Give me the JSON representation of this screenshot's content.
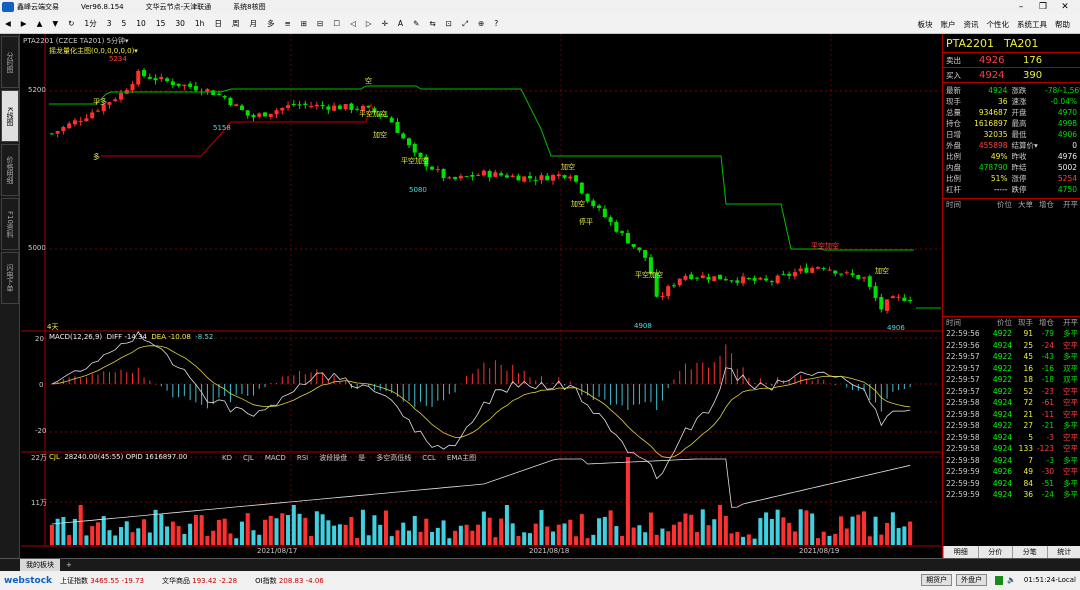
{
  "window": {
    "app_title": "鑫峰云端交易",
    "version": "Ver96.8.154",
    "node": "文华云节点-天津联通",
    "system_info": "系统8核图"
  },
  "toolbar": {
    "items": [
      "◀",
      "▶",
      "▲",
      "▼",
      "↻",
      "1分",
      "3",
      "5",
      "10",
      "15",
      "30",
      "1h",
      "日",
      "周",
      "月",
      "多",
      "≡",
      "⊞",
      "⊟",
      "☐",
      "◁",
      "▷",
      "✛",
      "A",
      "✎",
      "⇆",
      "⊡",
      "⤢",
      "⊕",
      "?"
    ],
    "menu": [
      "板块",
      "账户",
      "资讯",
      "个性化",
      "系统工具",
      "帮助"
    ]
  },
  "left_tabs": [
    "分时图",
    "K线图",
    "价格明细",
    "F10资料",
    "闪电下单"
  ],
  "chart_header": {
    "symbol_line": "PTA2201  (CZCE TA201)  5分钟▾",
    "indicator_line": "摇龙量化主图(0,0,0,0,0,0)▾"
  },
  "price_axis": {
    "high_label": "5200",
    "low_label": "5000"
  },
  "annotations": {
    "high_price": "5234",
    "low1": "5158",
    "low2": "5080",
    "low3": "4908",
    "low4": "4906",
    "period": "4天",
    "signals": [
      "空",
      "多",
      "平多",
      "平空加空",
      "加空",
      "平空加空",
      "加空",
      "加空",
      "停平",
      "平空加空",
      "平空加空",
      "加空"
    ]
  },
  "macd": {
    "label": "MACD(12,26,9)",
    "diff": "DIFF -14.34",
    "dea": "DEA -10.08",
    "macd": "-8.52",
    "axis": [
      "20",
      "0",
      "-20"
    ]
  },
  "volume": {
    "label": "CJL",
    "values": "28240.00(45:55)  OPID 1616897.00",
    "tabs": [
      "KD",
      "CJL",
      "MACD",
      "RSI",
      "波段操盘",
      "是",
      "多空高低线",
      "CCL",
      "EMA主图"
    ],
    "axis": [
      "22万",
      "11万"
    ]
  },
  "dates": [
    "2021/08/17",
    "2021/08/18",
    "2021/08/19"
  ],
  "chart_data": {
    "type": "candlestick",
    "title": "PTA2201 5分钟",
    "y_range": [
      4880,
      5260
    ],
    "points": 150,
    "key_levels": {
      "high": 5234,
      "lows": [
        5158,
        5080,
        4908,
        4906
      ]
    },
    "series": [
      {
        "name": "DIFF",
        "last": -14.34
      },
      {
        "name": "DEA",
        "last": -10.08
      },
      {
        "name": "MACD",
        "last": -8.52
      }
    ]
  },
  "quote": {
    "symbol": "PTA2201",
    "code": "TA201",
    "sell": {
      "label": "卖出",
      "price": "4926",
      "vol": "176"
    },
    "buy": {
      "label": "买入",
      "price": "4924",
      "vol": "390"
    },
    "rows": [
      {
        "l1": "最新",
        "v1": "4924",
        "c1": "green",
        "l2": "涨跌",
        "v2": "-78/-1.56%",
        "c2": "green"
      },
      {
        "l1": "现手",
        "v1": "36",
        "c1": "yellow",
        "l2": "速涨",
        "v2": "-0.04%",
        "c2": "green"
      },
      {
        "l1": "总量",
        "v1": "934687",
        "c1": "yellow",
        "l2": "开盘",
        "v2": "4970",
        "c2": "green"
      },
      {
        "l1": "持仓",
        "v1": "1616897",
        "c1": "yellow",
        "l2": "最高",
        "v2": "4998",
        "c2": "green"
      },
      {
        "l1": "日增",
        "v1": "32035",
        "c1": "yellow",
        "l2": "最低",
        "v2": "4906",
        "c2": "green"
      },
      {
        "l1": "外盘",
        "v1": "455898",
        "c1": "red",
        "l2": "结算价▾",
        "v2": "0",
        "c2": "white"
      },
      {
        "l1": "比例",
        "v1": "49%",
        "c1": "yellow",
        "l2": "昨收",
        "v2": "4976",
        "c2": "white"
      },
      {
        "l1": "内盘",
        "v1": "478790",
        "c1": "green",
        "l2": "昨结",
        "v2": "5002",
        "c2": "white"
      },
      {
        "l1": "比例",
        "v1": "51%",
        "c1": "yellow",
        "l2": "涨停",
        "v2": "5254",
        "c2": "red"
      },
      {
        "l1": "杠杆",
        "v1": "-----",
        "c1": "white",
        "l2": "跌停",
        "v2": "4750",
        "c2": "green"
      }
    ],
    "trade_headers": [
      "时间",
      "价位",
      "大单",
      "增仓",
      "开平"
    ],
    "tick_headers": [
      "时间",
      "价位",
      "现手",
      "增仓",
      "开平"
    ],
    "ticks": [
      {
        "t": "22:59:56",
        "p": "4922",
        "v": "91",
        "c": "-79",
        "k": "多平",
        "cc": "green"
      },
      {
        "t": "22:59:56",
        "p": "4924",
        "v": "25",
        "c": "-24",
        "k": "空平",
        "cc": "red"
      },
      {
        "t": "22:59:57",
        "p": "4922",
        "v": "45",
        "c": "-43",
        "k": "多平",
        "cc": "green"
      },
      {
        "t": "22:59:57",
        "p": "4922",
        "v": "16",
        "c": "-16",
        "k": "双平",
        "cc": "green"
      },
      {
        "t": "22:59:57",
        "p": "4922",
        "v": "18",
        "c": "-18",
        "k": "双平",
        "cc": "green"
      },
      {
        "t": "22:59:57",
        "p": "4922",
        "v": "52",
        "c": "-23",
        "k": "空平",
        "cc": "red"
      },
      {
        "t": "22:59:58",
        "p": "4924",
        "v": "72",
        "c": "-61",
        "k": "空平",
        "cc": "red"
      },
      {
        "t": "22:59:58",
        "p": "4924",
        "v": "21",
        "c": "-11",
        "k": "空平",
        "cc": "red"
      },
      {
        "t": "22:59:58",
        "p": "4922",
        "v": "27",
        "c": "-21",
        "k": "多平",
        "cc": "green"
      },
      {
        "t": "22:59:58",
        "p": "4924",
        "v": "5",
        "c": "-3",
        "k": "空平",
        "cc": "red"
      },
      {
        "t": "22:59:58",
        "p": "4924",
        "v": "133",
        "c": "-123",
        "k": "空平",
        "cc": "red"
      },
      {
        "t": "22:59:58",
        "p": "4924",
        "v": "7",
        "c": "-3",
        "k": "多平",
        "cc": "green"
      },
      {
        "t": "22:59:59",
        "p": "4926",
        "v": "49",
        "c": "-30",
        "k": "空平",
        "cc": "red"
      },
      {
        "t": "22:59:59",
        "p": "4924",
        "v": "84",
        "c": "-51",
        "k": "多平",
        "cc": "green"
      },
      {
        "t": "22:59:59",
        "p": "4924",
        "v": "36",
        "c": "-24",
        "k": "多平",
        "cc": "green"
      }
    ],
    "bottom_tabs": [
      "明细",
      "分价",
      "分笔",
      "统计"
    ]
  },
  "bottom_tab": {
    "label": "我的板块",
    "plus": "+"
  },
  "status": {
    "brand": "webstock",
    "indices": [
      {
        "name": "上证指数",
        "value": "3465.55 -19.73"
      },
      {
        "name": "文华商品",
        "value": "193.42 -2.28"
      },
      {
        "name": "OI指数",
        "value": "208.83 -4.06"
      }
    ],
    "buttons": [
      "期货户",
      "外盘户"
    ],
    "clock": "01:51:24-Local"
  }
}
